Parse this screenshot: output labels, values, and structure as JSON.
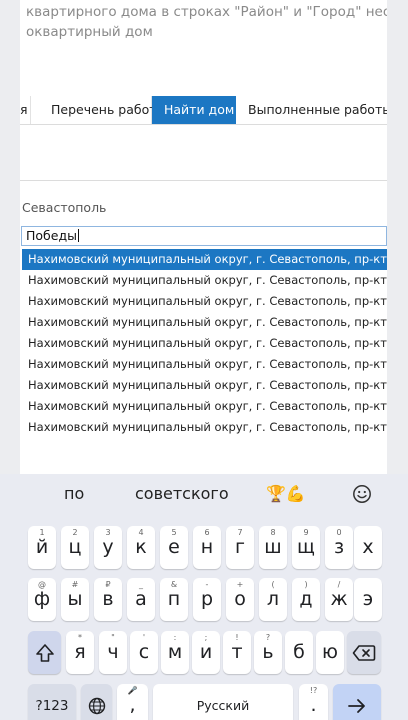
{
  "page": {
    "intro_lines": [
      "квартирного дома в строках \"Район\" и \"Город\" нео",
      "оквартирный дом"
    ],
    "tabs": [
      {
        "label": "я",
        "active": false
      },
      {
        "label": "Перечень работ",
        "active": false
      },
      {
        "label": "Найти дом",
        "active": true
      },
      {
        "label": "Выполненные работы",
        "active": false
      }
    ],
    "city_label": "Севастополь",
    "search_value": "Победы",
    "suggestions": [
      "Нахимовский муниципальный округ, г. Севастополь, пр-кт Побе",
      "Нахимовский муниципальный округ, г. Севастополь, пр-кт Побе",
      "Нахимовский муниципальный округ, г. Севастополь, пр-кт Побе",
      "Нахимовский муниципальный округ, г. Севастополь, пр-кт Побе",
      "Нахимовский муниципальный округ, г. Севастополь, пр-кт Побе",
      "Нахимовский муниципальный округ, г. Севастополь, пр-кт Побе",
      "Нахимовский муниципальный округ, г. Севастополь, пр-кт Побе",
      "Нахимовский муниципальный округ, г. Севастополь, пр-кт Побе",
      "Нахимовский муниципальный округ, г. Севастополь, пр-кт Побе"
    ],
    "accent_color": "#1c77c3"
  },
  "keyboard": {
    "predictions": [
      "по",
      "советского",
      "🏆💪"
    ],
    "emoji_icon": "smiley-icon",
    "row1": [
      {
        "ch": "й",
        "hint": "1"
      },
      {
        "ch": "ц",
        "hint": "2"
      },
      {
        "ch": "у",
        "hint": "3"
      },
      {
        "ch": "к",
        "hint": "4"
      },
      {
        "ch": "е",
        "hint": "5"
      },
      {
        "ch": "н",
        "hint": "6"
      },
      {
        "ch": "г",
        "hint": "7"
      },
      {
        "ch": "ш",
        "hint": "8"
      },
      {
        "ch": "щ",
        "hint": "9"
      },
      {
        "ch": "з",
        "hint": "0"
      },
      {
        "ch": "х",
        "hint": ""
      }
    ],
    "row2": [
      {
        "ch": "ф",
        "hint": "@"
      },
      {
        "ch": "ы",
        "hint": "#"
      },
      {
        "ch": "в",
        "hint": "₽"
      },
      {
        "ch": "а",
        "hint": "_"
      },
      {
        "ch": "п",
        "hint": "&"
      },
      {
        "ch": "р",
        "hint": "-"
      },
      {
        "ch": "о",
        "hint": "+"
      },
      {
        "ch": "л",
        "hint": "("
      },
      {
        "ch": "д",
        "hint": ")"
      },
      {
        "ch": "ж",
        "hint": "/"
      },
      {
        "ch": "э",
        "hint": ""
      }
    ],
    "row3": [
      {
        "ch": "я",
        "hint": "*"
      },
      {
        "ch": "ч",
        "hint": "\""
      },
      {
        "ch": "с",
        "hint": "'"
      },
      {
        "ch": "м",
        "hint": ":"
      },
      {
        "ch": "и",
        "hint": ";"
      },
      {
        "ch": "т",
        "hint": "!"
      },
      {
        "ch": "ь",
        "hint": "?"
      },
      {
        "ch": "б",
        "hint": ""
      },
      {
        "ch": "ю",
        "hint": ""
      }
    ],
    "symbols_label": "?123",
    "comma_hint": "🎤",
    "space_label": "Русский",
    "period_hint": "!?",
    "period_label": "."
  }
}
